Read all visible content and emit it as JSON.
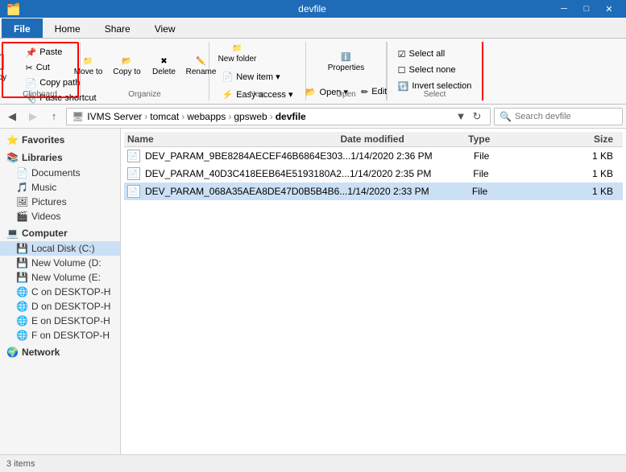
{
  "titlebar": {
    "title": "devfile",
    "minimize": "─",
    "maximize": "□",
    "close": "✕"
  },
  "ribbon_tabs": [
    {
      "label": "File",
      "active": true
    },
    {
      "label": "Home",
      "active": false
    },
    {
      "label": "Share",
      "active": false
    },
    {
      "label": "View",
      "active": false
    }
  ],
  "ribbon": {
    "clipboard_group": "Clipboard",
    "organize_group": "Organize",
    "new_group": "New",
    "open_group": "Open",
    "select_group": "Select",
    "copy_btn": "Copy",
    "paste_btn": "Paste",
    "cut_label": "Cut",
    "copypath_label": "Copy path",
    "paste_shortcut_label": "Paste shortcut",
    "moveto_label": "Move to",
    "copyto_label": "Copy to",
    "delete_label": "Delete",
    "rename_label": "Rename",
    "newfolder_label": "New folder",
    "newitem_label": "New item ▾",
    "easyaccess_label": "Easy access ▾",
    "properties_label": "Properties",
    "open_label": "Open ▾",
    "edit_label": "Edit",
    "selectall_label": "Select all",
    "selectnone_label": "Select none",
    "invertselection_label": "Invert selection"
  },
  "addressbar": {
    "path_parts": [
      "IVMS Server",
      "tomcat",
      "webapps",
      "gpsweb",
      "devfile"
    ],
    "search_placeholder": "Search devfile"
  },
  "sidebar": {
    "favorites_label": "Favorites",
    "libraries_label": "Libraries",
    "documents_label": "Documents",
    "music_label": "Music",
    "pictures_label": "Pictures",
    "videos_label": "Videos",
    "computer_label": "Computer",
    "localdisk_label": "Local Disk (C:)",
    "volumed_label": "New Volume (D:",
    "volumee_label": "New Volume (E:",
    "con_label": "C on DESKTOP-H",
    "don_label": "D on DESKTOP-H",
    "eon_label": "E on DESKTOP-H",
    "fon_label": "F on DESKTOP-H",
    "network_label": "Network"
  },
  "filelist": {
    "col_name": "Name",
    "col_date": "Date modified",
    "col_type": "Type",
    "col_size": "Size",
    "files": [
      {
        "name": "DEV_PARAM_9BE8284AECEF46B6864E303...",
        "date": "1/14/2020 2:36 PM",
        "type": "File",
        "size": "1 KB",
        "selected": false
      },
      {
        "name": "DEV_PARAM_40D3C418EEB64E5193180A2...",
        "date": "1/14/2020 2:35 PM",
        "type": "File",
        "size": "1 KB",
        "selected": false
      },
      {
        "name": "DEV_PARAM_068A35AEA8DE47D0B5B4B6...",
        "date": "1/14/2020 2:33 PM",
        "type": "File",
        "size": "1 KB",
        "selected": true
      }
    ]
  },
  "statusbar": {
    "text": "3 items"
  }
}
